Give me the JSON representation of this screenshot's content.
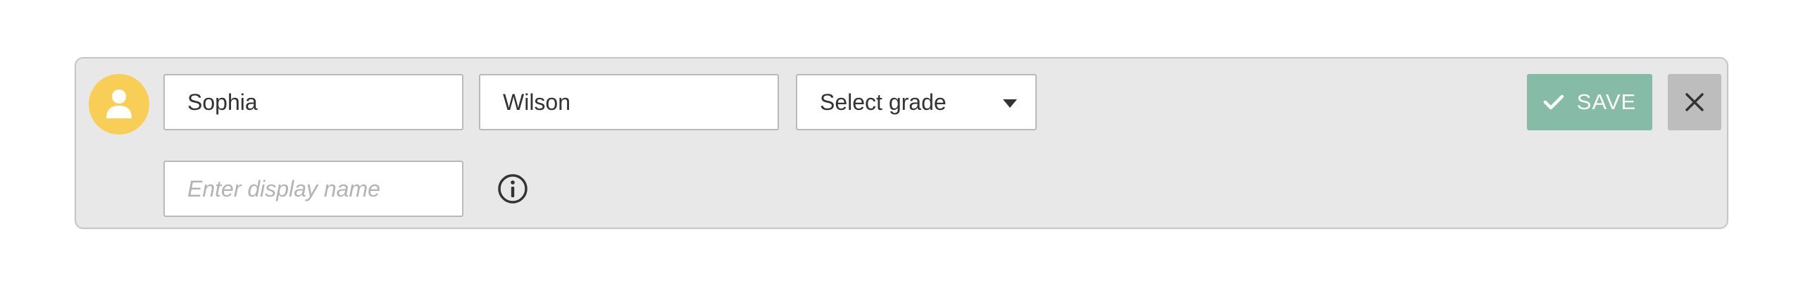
{
  "form": {
    "first_name": "Sophia",
    "last_name": "Wilson",
    "grade_select": "Select grade",
    "display_name_placeholder": "Enter display name",
    "save_label": "SAVE"
  },
  "icons": {
    "avatar": "user-icon",
    "grade_caret": "chevron-down-icon",
    "info": "info-icon",
    "save": "check-icon",
    "close": "close-icon"
  },
  "colors": {
    "avatar": "#f8ce56",
    "save": "#86bba7",
    "close": "#bdbdbd",
    "card": "#e8e8e8"
  }
}
